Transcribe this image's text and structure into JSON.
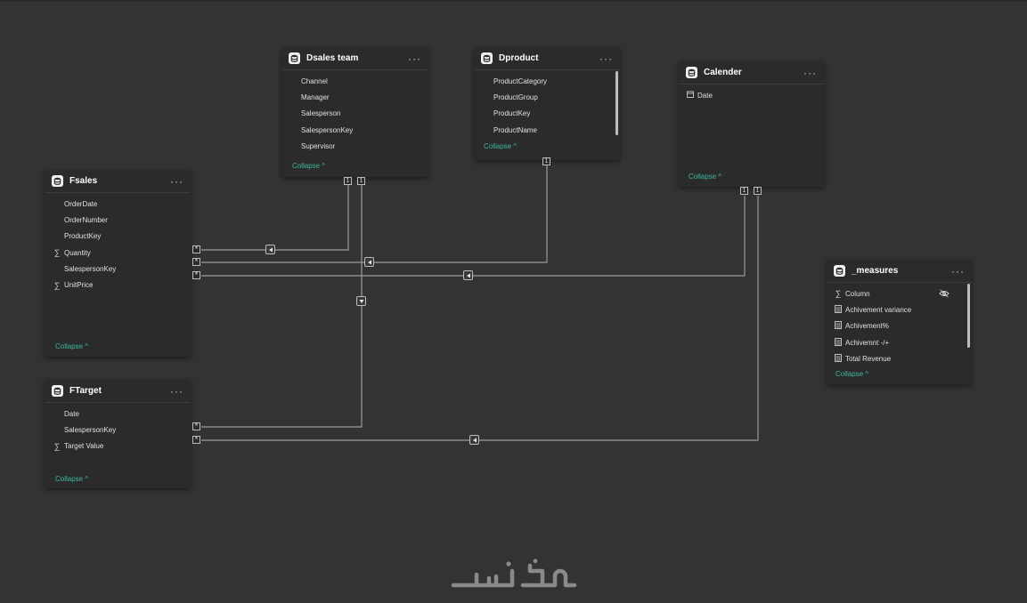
{
  "tables": {
    "dsales": {
      "title": "Dsales team",
      "fields": [
        {
          "name": "Channel",
          "icon": ""
        },
        {
          "name": "Manager",
          "icon": ""
        },
        {
          "name": "Salesperson",
          "icon": ""
        },
        {
          "name": "SalespersonKey",
          "icon": ""
        },
        {
          "name": "Supervisor",
          "icon": ""
        }
      ],
      "collapse": "Collapse ^"
    },
    "dproduct": {
      "title": "Dproduct",
      "fields": [
        {
          "name": "ProductCategory",
          "icon": ""
        },
        {
          "name": "ProductGroup",
          "icon": ""
        },
        {
          "name": "ProductKey",
          "icon": ""
        },
        {
          "name": "ProductName",
          "icon": ""
        }
      ],
      "collapse": "Collapse ^"
    },
    "calender": {
      "title": "Calender",
      "fields": [
        {
          "name": "Date",
          "icon": "calendar-icon"
        }
      ],
      "collapse": "Collapse ^"
    },
    "fsales": {
      "title": "Fsales",
      "fields": [
        {
          "name": "OrderDate",
          "icon": ""
        },
        {
          "name": "OrderNumber",
          "icon": ""
        },
        {
          "name": "ProductKey",
          "icon": ""
        },
        {
          "name": "Quantity",
          "icon": "sigma-icon"
        },
        {
          "name": "SalespersonKey",
          "icon": ""
        },
        {
          "name": "UnitPrice",
          "icon": "sigma-icon"
        }
      ],
      "collapse": "Collapse ^"
    },
    "ftarget": {
      "title": "FTarget",
      "fields": [
        {
          "name": "Date",
          "icon": ""
        },
        {
          "name": "SalespersonKey",
          "icon": ""
        },
        {
          "name": "Target Value",
          "icon": "sigma-icon"
        }
      ],
      "collapse": "Collapse ^"
    },
    "measures": {
      "title": "_measures",
      "fields": [
        {
          "name": "Column",
          "icon": "sigma-icon",
          "hidden": true
        },
        {
          "name": "Achivement variance",
          "icon": "calculator-icon"
        },
        {
          "name": "Achivement%",
          "icon": "calculator-icon"
        },
        {
          "name": "Achivemnt -/+",
          "icon": "calculator-icon"
        },
        {
          "name": "Total Revenue",
          "icon": "calculator-icon"
        }
      ],
      "collapse": "Collapse ^"
    }
  },
  "markers": {
    "one": "1",
    "many": "*"
  },
  "colors": {
    "canvas": "#333333",
    "card": "#2b2b2b",
    "collapse": "#3fb8a0",
    "line": "#9a9a9a"
  },
  "watermark": {
    "icon": "khamsat-logo-icon"
  }
}
